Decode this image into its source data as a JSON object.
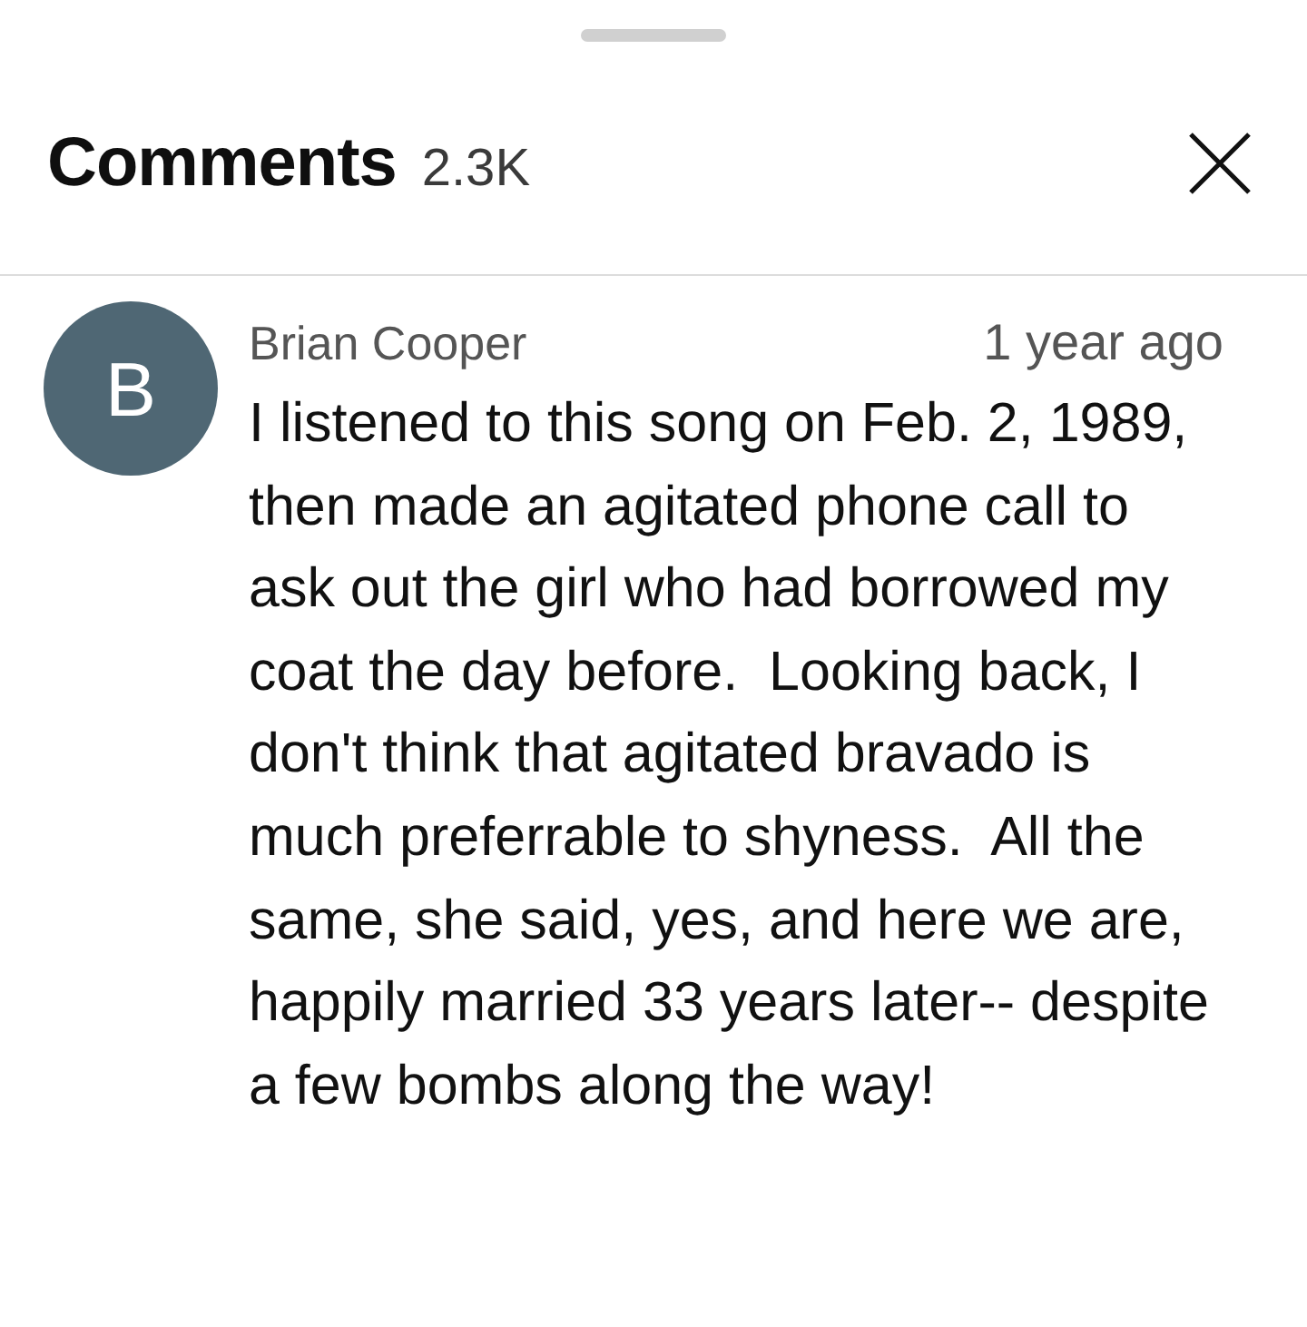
{
  "header": {
    "title": "Comments",
    "count": "2.3K"
  },
  "comments": [
    {
      "avatar_letter": "B",
      "author": "Brian Cooper",
      "time": "1 year ago",
      "text": "I listened to this song on Feb. 2, 1989, then made an agitated phone call to ask out the girl who had borrowed my coat the day before.  Looking back, I don't think that agitated bravado is much preferrable to shyness.  All the same, she said, yes, and here we are, happily married 33 years later-- despite a few bombs along the way!"
    }
  ]
}
